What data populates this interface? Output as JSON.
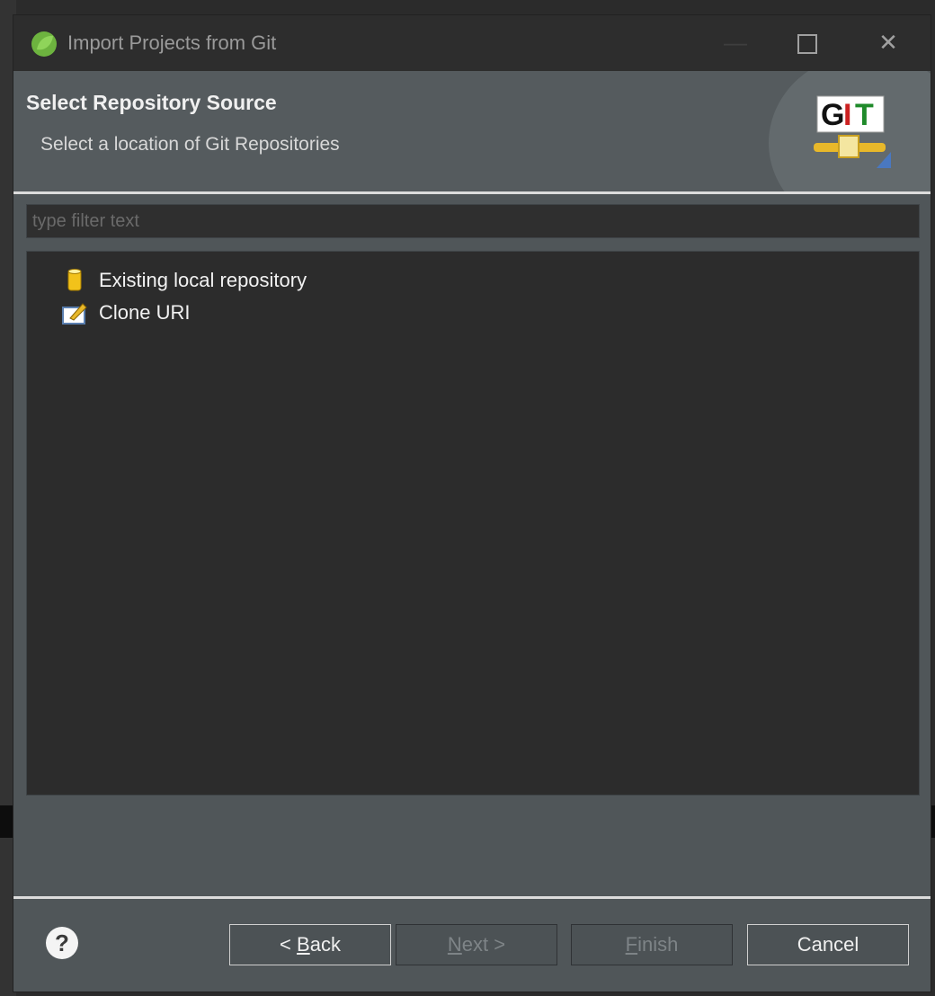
{
  "window": {
    "title": "Import Projects from Git",
    "minimize_label": "—",
    "close_label": "✕"
  },
  "header": {
    "title": "Select Repository Source",
    "subtitle": "Select a location of Git Repositories",
    "logo_text": "GIT"
  },
  "filter": {
    "placeholder": "type filter text"
  },
  "tree": {
    "items": [
      {
        "label": "Existing local repository",
        "icon": "repository-cylinder-icon"
      },
      {
        "label": "Clone URI",
        "icon": "clone-uri-icon"
      }
    ]
  },
  "footer": {
    "help_label": "?",
    "buttons": {
      "back_prefix": "< ",
      "back_mnemonic": "B",
      "back_rest": "ack",
      "next_mnemonic": "N",
      "next_rest": "ext >",
      "finish_mnemonic": "F",
      "finish_rest": "inish",
      "cancel": "Cancel"
    }
  },
  "colors": {
    "accent_orange": "#c96a1f",
    "git_red": "#cc2222",
    "git_green": "#1f8a2a",
    "logo_gold": "#e8b82a"
  }
}
